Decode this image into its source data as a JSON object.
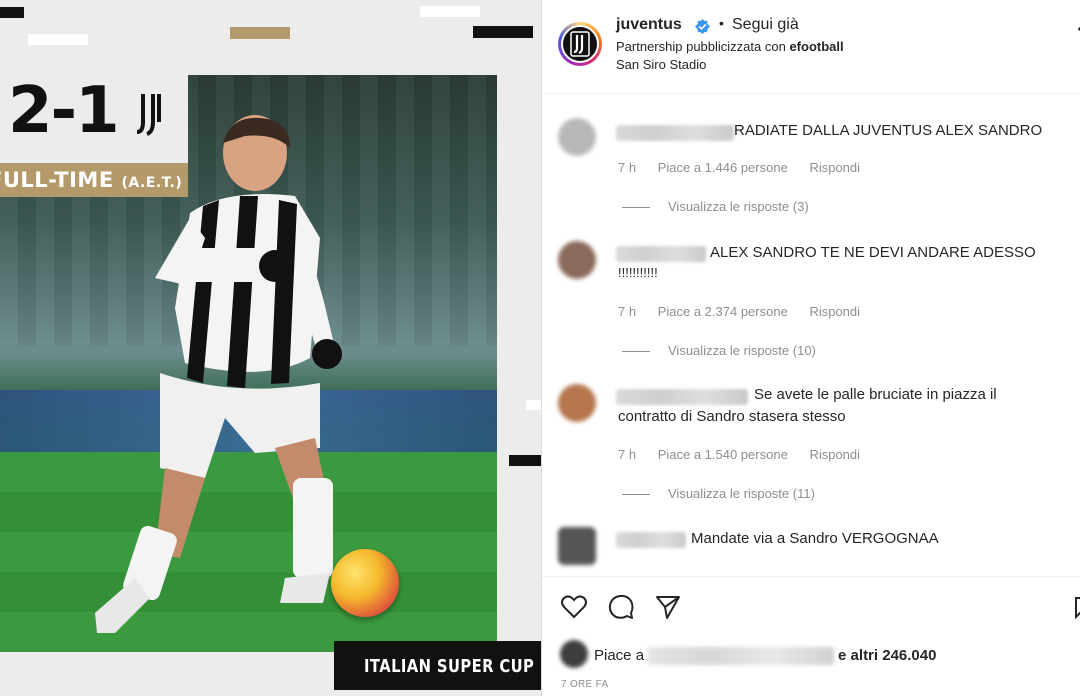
{
  "post": {
    "score": "2-1",
    "status_main": "FULL-TIME",
    "status_note": "(A.E.T.)",
    "competition": "ITALIAN SUPER CUP"
  },
  "header": {
    "username": "juventus",
    "separator": "•",
    "follow_state": "Segui già",
    "partnership_prefix": "Partnership pubblicizzata con ",
    "partner": "efootball",
    "location": "San Siro Stadio"
  },
  "comments": [
    {
      "text": "RADIATE DALLA JUVENTUS ALEX SANDRO",
      "text_line2": "",
      "time": "7 h",
      "likes": "Piace a 1.446 persone",
      "reply": "Rispondi",
      "view_replies": "Visualizza le risposte (3)"
    },
    {
      "text": "ALEX SANDRO TE NE DEVI ANDARE ADESSO",
      "text_line2": "!!!!!!!!!!!",
      "time": "7 h",
      "likes": "Piace a 2.374 persone",
      "reply": "Rispondi",
      "view_replies": "Visualizza le risposte (10)"
    },
    {
      "text": "Se avete le palle bruciate in piazza il",
      "text_line2": "contratto di Sandro stasera stesso",
      "time": "7 h",
      "likes": "Piace a 1.540 persone",
      "reply": "Rispondi",
      "view_replies": "Visualizza le risposte (11)"
    },
    {
      "text": "Mandate via a Sandro VERGOGNAA",
      "text_line2": "",
      "time": "",
      "likes": "",
      "reply": "",
      "view_replies": ""
    }
  ],
  "actions": {
    "icons": [
      "heart-icon",
      "comment-icon",
      "share-icon",
      "bookmark-icon"
    ],
    "likes_prefix": "Piace a",
    "likes_suffix": "e altri 246.040",
    "time_ago": "7 ORE FA"
  },
  "colors": {
    "accent_gold": "#b49a6a",
    "verified_blue": "#3897f0",
    "meta_gray": "#8e8e8e",
    "text": "#262626"
  }
}
